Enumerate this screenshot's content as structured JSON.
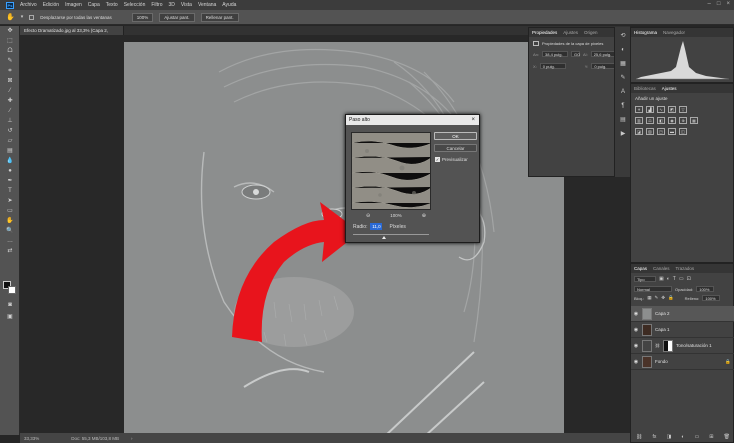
{
  "menubar": {
    "items": [
      "Archivo",
      "Edición",
      "Imagen",
      "Capa",
      "Texto",
      "Selección",
      "Filtro",
      "3D",
      "Vista",
      "Ventana",
      "Ayuda"
    ],
    "logo": "Ps"
  },
  "optionsbar": {
    "scroll_all": "Desplazarse por todas las ventanas",
    "zoom": "100%",
    "fit": "Ajustar pant.",
    "fill": "Rellenar pant."
  },
  "document": {
    "tab": "Efecto Dramatizado.jpg al 33,3% (Capa 2, RGB/8*) ×",
    "zoom": "33,33%",
    "doc_size": "Doc: 55,3 MB/103,8 MB"
  },
  "properties": {
    "tabs": [
      "Propiedades",
      "Ajustes",
      "Origen"
    ],
    "subtitle": "Propiedades de la capa de píxeles",
    "w_label": "An:",
    "w_value": "38,4 pulg.",
    "link": "GO",
    "h_label": "Al:",
    "h_value": "25,6 pulg.",
    "x_label": "X:",
    "x_value": "0 pulg.",
    "y_label": "Y:",
    "y_value": "0 pulg."
  },
  "histogram": {
    "tabs": [
      "Histograma",
      "Navegador"
    ]
  },
  "adjust": {
    "tabs": [
      "Bibliotecas",
      "Ajustes"
    ],
    "hint": "Añadir un ajuste"
  },
  "layers": {
    "tabs": [
      "Capas",
      "Canales",
      "Trazados"
    ],
    "filter": "Tipo",
    "blend": "Normal",
    "opacity_label": "Opacidad:",
    "opacity": "100%",
    "lock_label": "Bloq.:",
    "fill_label": "Relleno:",
    "fill": "100%",
    "items": [
      {
        "name": "Capa 2"
      },
      {
        "name": "Capa 1"
      },
      {
        "name": "Tono/saturación 1"
      },
      {
        "name": "Fondo"
      }
    ]
  },
  "dialog": {
    "title": "Paso alto",
    "ok": "OK",
    "cancel": "Cancelar",
    "preview_label": "Previsualizar",
    "zoom": "100%",
    "radius_label": "Radio:",
    "radius_value": "11,0",
    "unit": "Píxeles"
  },
  "colors": {
    "arrow": "#e8141c",
    "canvas_gray": "#8c8e8e",
    "dialog_bg": "#535353"
  }
}
